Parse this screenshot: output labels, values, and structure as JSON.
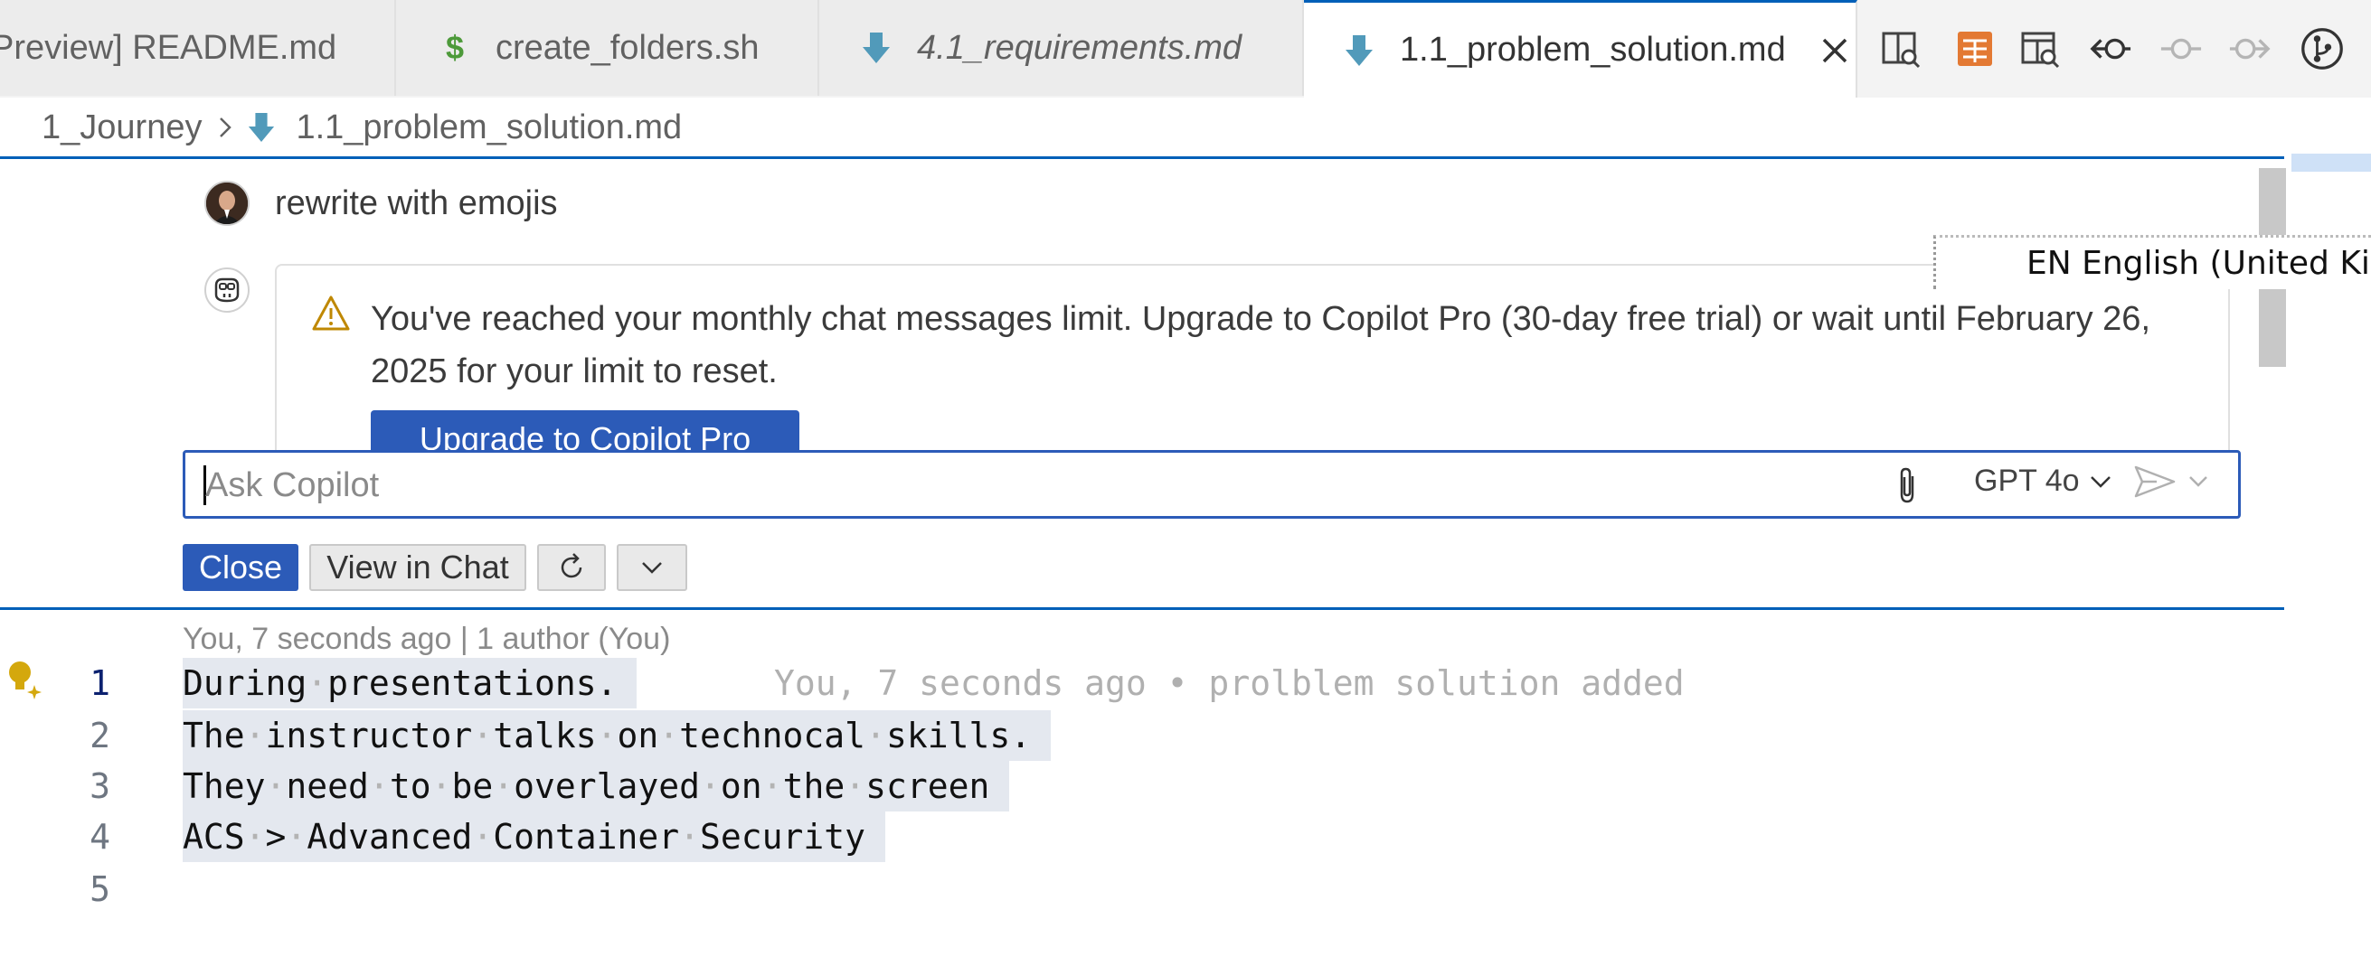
{
  "tabs": [
    {
      "label": "Preview] README.md",
      "icon": "none",
      "italic": false,
      "active": false
    },
    {
      "label": "create_folders.sh",
      "icon": "dollar-icon",
      "italic": false,
      "active": false
    },
    {
      "label": "4.1_requirements.md",
      "icon": "markdown-arrow-icon",
      "italic": true,
      "active": false
    },
    {
      "label": "1.1_problem_solution.md",
      "icon": "markdown-arrow-icon",
      "italic": false,
      "active": true
    }
  ],
  "toolbar_icons": [
    "split-preview-icon",
    "table-icon",
    "open-preview-icon",
    "go-back-icon",
    "commit-icon",
    "go-forward-icon",
    "source-control-graph-icon"
  ],
  "breadcrumb": {
    "folder": "1_Journey",
    "file": "1.1_problem_solution.md"
  },
  "chat": {
    "user_message": "rewrite with emojis",
    "limit_message": "You've reached your monthly chat messages limit. Upgrade to Copilot Pro (30-day free trial) or wait until February 26, 2025 for your limit to reset.",
    "upgrade_button": "Upgrade to Copilot Pro",
    "input_placeholder": "Ask Copilot",
    "model": "GPT 4o",
    "buttons": {
      "close": "Close",
      "view_in_chat": "View in Chat"
    }
  },
  "language_indicator": "EN English (United Kingdom)",
  "editor": {
    "blame_header": "You, 7 seconds ago | 1 author (You)",
    "inline_blame": "You, 7 seconds ago • prolblem solution added",
    "lines": [
      {
        "number": "1",
        "text": "During presentations."
      },
      {
        "number": "2",
        "text": "The instructor talks on technocal skills."
      },
      {
        "number": "3",
        "text": "They need to be overlayed on the screen"
      },
      {
        "number": "4",
        "text": "ACS > Advanced Container Security"
      },
      {
        "number": "5",
        "text": ""
      }
    ]
  },
  "colors": {
    "accent": "#005fb8",
    "button_primary": "#2c5bb8",
    "warning": "#bf8803",
    "markdown_icon": "#519aba",
    "shell_icon": "#4d9a3a",
    "table_icon": "#e37933"
  }
}
